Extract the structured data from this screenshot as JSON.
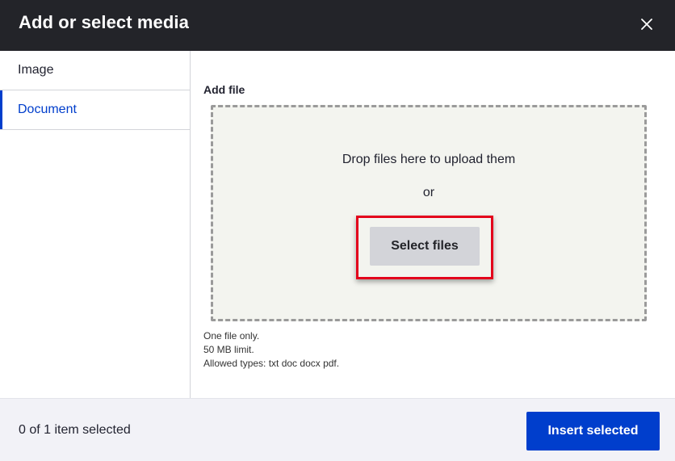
{
  "dialog": {
    "title": "Add or select media",
    "close_icon": "close-icon"
  },
  "sidebar": {
    "tabs": [
      {
        "label": "Image",
        "active": false
      },
      {
        "label": "Document",
        "active": true
      }
    ]
  },
  "upload": {
    "label": "Add file",
    "drop_text": "Drop files here to upload them",
    "or_text": "or",
    "select_button": "Select files",
    "help": [
      "One file only.",
      "50 MB limit.",
      "Allowed types: txt doc docx pdf."
    ]
  },
  "footer": {
    "selection_count": "0 of 1 item selected",
    "insert_button": "Insert selected"
  },
  "colors": {
    "header_bg": "#232429",
    "accent": "#003ecc",
    "highlight": "#e3001b",
    "dropzone_bg": "#f3f4ef"
  }
}
